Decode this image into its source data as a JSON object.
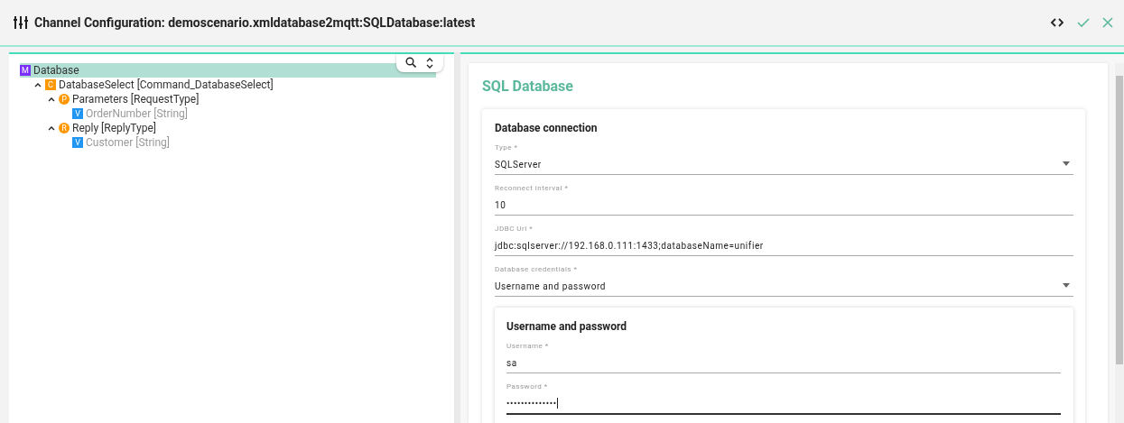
{
  "window": {
    "title": "Channel Configuration: demoscenario.xmldatabase2mqtt:SQLDatabase:latest"
  },
  "tree": [
    {
      "badge": "M",
      "color": "#7b2ff7",
      "kind": "square",
      "label": "Database",
      "muted": false,
      "selected": true,
      "children": [
        {
          "badge": "C",
          "color": "#ff9800",
          "kind": "square",
          "label": "DatabaseSelect [Command_DatabaseSelect]",
          "muted": false,
          "selected": false,
          "expanded": true,
          "children": [
            {
              "badge": "P",
              "color": "#ff9800",
              "kind": "circle",
              "label": "Parameters [RequestType]",
              "muted": false,
              "selected": false,
              "expanded": true,
              "children": [
                {
                  "badge": "V",
                  "color": "#2196f3",
                  "kind": "square",
                  "label": "OrderNumber [String]",
                  "muted": true,
                  "selected": false
                }
              ]
            },
            {
              "badge": "R",
              "color": "#ff9800",
              "kind": "circle",
              "label": "Reply [ReplyType]",
              "muted": false,
              "selected": false,
              "expanded": true,
              "children": [
                {
                  "badge": "V",
                  "color": "#2196f3",
                  "kind": "square",
                  "label": "Customer [String]",
                  "muted": true,
                  "selected": false
                }
              ]
            }
          ]
        }
      ]
    }
  ],
  "form": {
    "title": "SQL Database",
    "section": {
      "title": "Database connection",
      "fields": [
        {
          "kind": "select",
          "label": "Type *",
          "value": "SQLServer",
          "focused": false
        },
        {
          "kind": "text",
          "label": "Reconnect interval *",
          "value": "10",
          "focused": false
        },
        {
          "kind": "text",
          "label": "JDBC Url *",
          "value": "jdbc:sqlserver://192.168.0.111:1433;databaseName=unifier",
          "focused": false
        },
        {
          "kind": "select",
          "label": "Database credentials *",
          "value": "Username and password",
          "focused": false
        }
      ]
    },
    "subsection": {
      "title": "Username and password",
      "fields": [
        {
          "kind": "text",
          "label": "Username *",
          "value": "sa",
          "focused": false
        },
        {
          "kind": "text",
          "label": "Password *",
          "value": "••••••••••••••",
          "focused": true
        }
      ]
    }
  }
}
